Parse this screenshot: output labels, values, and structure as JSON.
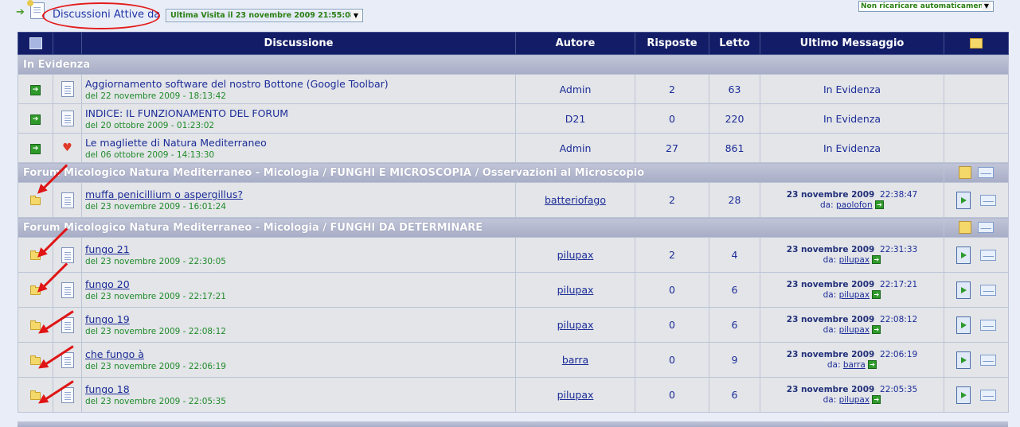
{
  "top": {
    "active_label": "Discussioni Attive da",
    "visit_select": "Ultima Visita il 23 novembre 2009 21:55:08",
    "reload_select": "Non ricaricare automaticamente"
  },
  "table": {
    "headers": {
      "discussione": "Discussione",
      "autore": "Autore",
      "risposte": "Risposte",
      "letto": "Letto",
      "ultimo": "Ultimo Messaggio"
    },
    "pinned_section": "In Evidenza",
    "pinned": [
      {
        "title": "Aggiornamento software del nostro Bottone (Google Toolbar)",
        "date": "del 22 novembre 2009 - 18:13:42",
        "author": "Admin",
        "replies": "2",
        "views": "63",
        "last": "In Evidenza"
      },
      {
        "title": "INDICE: IL FUNZIONAMENTO DEL FORUM",
        "date": "del 20 ottobre 2009 - 01:23:02",
        "author": "D21",
        "replies": "0",
        "views": "220",
        "last": "In Evidenza"
      },
      {
        "title": "Le magliette di Natura Mediterraneo",
        "date": "del 06 ottobre 2009 - 14:13:30",
        "author": "Admin",
        "replies": "27",
        "views": "861",
        "last": "In Evidenza"
      }
    ],
    "forum1": {
      "title": "Forum Micologico Natura Mediterraneo - Micologia / FUNGHI E MICROSCOPIA / Osservazioni al Microscopio",
      "topics": [
        {
          "title": "muffa penicillium o aspergillus?",
          "date": "del 23 novembre 2009 - 16:01:24",
          "author": "batteriofago",
          "replies": "2",
          "views": "28",
          "last_date": "23 novembre 2009",
          "last_time": "22:38:47",
          "by_label": "da:",
          "last_by": "paolofon"
        }
      ]
    },
    "forum2": {
      "title": "Forum Micologico Natura Mediterraneo - Micologia / FUNGHI DA DETERMINARE",
      "topics": [
        {
          "title": "fungo 21",
          "date": "del 23 novembre 2009 - 22:30:05",
          "author": "pilupax",
          "replies": "2",
          "views": "4",
          "last_date": "23 novembre 2009",
          "last_time": "22:31:33",
          "by_label": "da:",
          "last_by": "pilupax"
        },
        {
          "title": "fungo 20",
          "date": "del 23 novembre 2009 - 22:17:21",
          "author": "pilupax",
          "replies": "0",
          "views": "6",
          "last_date": "23 novembre 2009",
          "last_time": "22:17:21",
          "by_label": "da:",
          "last_by": "pilupax"
        },
        {
          "title": "fungo 19",
          "date": "del 23 novembre 2009 - 22:08:12",
          "author": "pilupax",
          "replies": "0",
          "views": "6",
          "last_date": "23 novembre 2009",
          "last_time": "22:08:12",
          "by_label": "da:",
          "last_by": "pilupax"
        },
        {
          "title": "che fungo à",
          "date": "del 23 novembre 2009 - 22:06:19",
          "author": "barra",
          "replies": "0",
          "views": "9",
          "last_date": "23 novembre 2009",
          "last_time": "22:06:19",
          "by_label": "da:",
          "last_by": "barra"
        },
        {
          "title": "fungo 18",
          "date": "del 23 novembre 2009 - 22:05:35",
          "author": "pilupax",
          "replies": "0",
          "views": "6",
          "last_date": "23 novembre 2009",
          "last_time": "22:05:35",
          "by_label": "da:",
          "last_by": "pilupax"
        }
      ]
    }
  },
  "icons": {
    "logo": "active-topics-icon",
    "go": "go-arrow-icon",
    "page": "page-icon",
    "heart": "heart-icon",
    "folder": "folder-icon",
    "book": "book-icon",
    "mail": "mail-icon",
    "new_topic": "new-topic-icon"
  },
  "colors": {
    "header_bg": "#131d67",
    "section_bg": "#b0b6cc",
    "row_bg": "#e3e5e8",
    "link": "#1c2c98",
    "date_green": "#1f8a2a",
    "annotation_red": "#e41b1b"
  }
}
